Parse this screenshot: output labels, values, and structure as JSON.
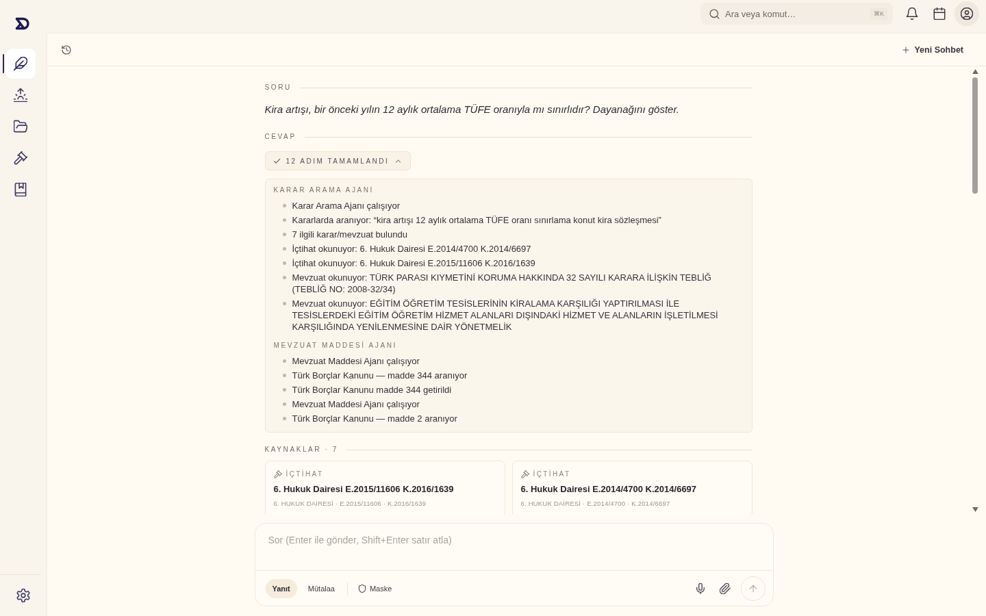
{
  "sidebar": {
    "nav": [
      {
        "kind": "feather",
        "selected": true
      },
      {
        "kind": "sunrise",
        "selected": false
      },
      {
        "kind": "folder",
        "selected": false
      },
      {
        "kind": "gavel",
        "selected": false
      },
      {
        "kind": "book",
        "selected": false
      }
    ]
  },
  "top_bar": {
    "search": {
      "placeholder": "Ara veya komut…",
      "shortcut": "⌘K"
    }
  },
  "toolbar": {
    "new_chat": "Yeni Sohbet"
  },
  "question": {
    "label": "SORU",
    "text": "Kira artışı, bir önceki yılın 12 aylık ortalama TÜFE oranıyla mı sınırlıdır? Dayanağını göster."
  },
  "answer": {
    "label": "CEVAP",
    "steps_toggle": {
      "label": "12 ADIM TAMAMLANDI",
      "expanded": true
    },
    "step_groups": [
      {
        "title": "KARAR ARAMA AJANI",
        "steps": [
          "Karar Arama Ajanı çalışıyor",
          "Kararlarda aranıyor: “kira artışı 12 aylık ortalama TÜFE oranı sınırlama konut kira sözleşmesi”",
          "7 ilgili karar/mevzuat bulundu",
          "İçtihat okunuyor: 6. Hukuk Dairesi E.2014/4700 K.2014/6697",
          "İçtihat okunuyor: 6. Hukuk Dairesi E.2015/11606 K.2016/1639",
          "Mevzuat okunuyor: TÜRK PARASI KIYMETİNİ KORUMA HAKKINDA 32 SAYILI KARARA İLİŞKİN TEBLİĞ (TEBLİĞ NO: 2008-32/34)",
          "Mevzuat okunuyor: EĞİTİM ÖĞRETİM TESİSLERİNİN KİRALAMA KARŞILIĞI YAPTIRILMASI İLE TESİSLERDEKİ EĞİTİM ÖĞRETİM HİZMET ALANLARI DIŞINDAKİ HİZMET VE ALANLARIN İŞLETİLMESİ KARŞILIĞINDA YENİLENMESİNE DAİR YÖNETMELİK"
        ]
      },
      {
        "title": "MEVZUAT MADDESİ AJANI",
        "steps": [
          "Mevzuat Maddesi Ajanı çalışıyor",
          "Türk Borçlar Kanunu — madde 344 aranıyor",
          "Türk Borçlar Kanunu madde 344 getirildi",
          "Mevzuat Maddesi Ajanı çalışıyor",
          "Türk Borçlar Kanunu — madde 2 aranıyor"
        ]
      }
    ]
  },
  "sources": {
    "label": "KAYNAKLAR · 7",
    "cards": [
      {
        "type": "İÇTİHAT",
        "title": "6. Hukuk Dairesi E.2015/11606 K.2016/1639",
        "meta": "6. HUKUK DAİRESİ · E.2015/11606 · K.2016/1639"
      },
      {
        "type": "İÇTİHAT",
        "title": "6. Hukuk Dairesi E.2014/4700 K.2014/6697",
        "meta": "6. HUKUK DAİRESİ · E.2014/4700 · K.2014/6697"
      }
    ]
  },
  "composer": {
    "placeholder": "Sor (Enter ile gönder, Shift+Enter satır atla)",
    "modes": [
      {
        "label": "Yanıt",
        "selected": true
      },
      {
        "label": "Mütalaa",
        "selected": false
      }
    ],
    "mask": "Maske"
  }
}
